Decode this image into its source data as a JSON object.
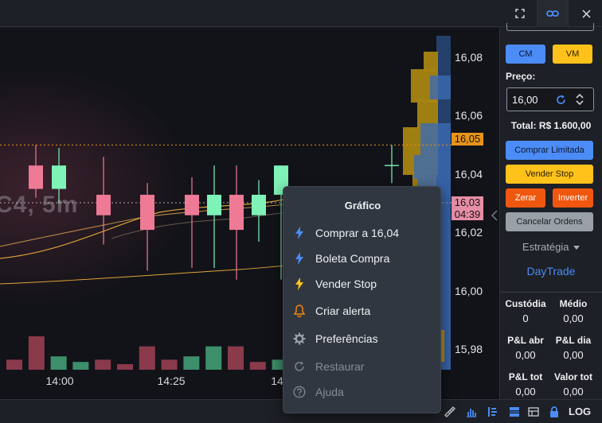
{
  "colors": {
    "bull": "#7ff2b8",
    "bear": "#ee7a95",
    "volume_bull": "#3c8f6a",
    "volume_bear": "#8a3a4b",
    "accent_blue": "#4b8cf6",
    "accent_yellow": "#ffc21a",
    "accent_orange": "#f0570e"
  },
  "chart": {
    "watermark": "C4, 5m",
    "last_price_tag": "16,05",
    "bid_tag": {
      "price": "16,03",
      "countdown": "04:39"
    },
    "price_axis": [
      "16,08",
      "16,06",
      "16,04",
      "16,02",
      "16,00",
      "15,98"
    ],
    "time_axis": [
      "14:00",
      "14:25",
      "14:"
    ]
  },
  "chart_data": {
    "type": "candlestick",
    "timeframe": "5m",
    "ylim": [
      15.97,
      16.09
    ],
    "x": [
      "14:00",
      "14:25"
    ],
    "candles": [
      {
        "open": 16.043,
        "close": 16.035,
        "high": 16.05,
        "low": 16.032
      },
      {
        "open": 16.035,
        "close": 16.043,
        "high": 16.049,
        "low": 16.03
      },
      {
        "open": 16.033,
        "close": 16.026,
        "high": 16.046,
        "low": 16.016
      },
      {
        "open": 16.033,
        "close": 16.021,
        "high": 16.037,
        "low": 16.007
      },
      {
        "open": 16.033,
        "close": 16.026,
        "high": 16.039,
        "low": 16.008
      },
      {
        "open": 16.026,
        "close": 16.033,
        "high": 16.043,
        "low": 16.008
      },
      {
        "open": 16.033,
        "close": 16.021,
        "high": 16.043,
        "low": 16.004
      },
      {
        "open": 16.026,
        "close": 16.033,
        "high": 16.038,
        "low": 16.017
      },
      {
        "open": 16.033,
        "close": 16.043,
        "high": 16.043,
        "low": 16.004
      },
      {
        "open": 16.043,
        "close": 16.043,
        "high": 16.05,
        "low": 16.037
      }
    ],
    "volume": [
      {
        "value": 9,
        "dir": "bear"
      },
      {
        "value": 30,
        "dir": "bear"
      },
      {
        "value": 12,
        "dir": "bull"
      },
      {
        "value": 7,
        "dir": "bull"
      },
      {
        "value": 9,
        "dir": "bear"
      },
      {
        "value": 5,
        "dir": "bear"
      },
      {
        "value": 21,
        "dir": "bear"
      },
      {
        "value": 9,
        "dir": "bear"
      },
      {
        "value": 12,
        "dir": "bull"
      },
      {
        "value": 21,
        "dir": "bull"
      },
      {
        "value": 21,
        "dir": "bear"
      },
      {
        "value": 7,
        "dir": "bear"
      },
      {
        "value": 9,
        "dir": "bull"
      },
      {
        "value": 15,
        "dir": "bull"
      },
      {
        "value": 16,
        "dir": "bull"
      }
    ],
    "last_price": 16.05,
    "bid_price": 16.03
  },
  "panel": {
    "cm_label": "CM",
    "vm_label": "VM",
    "price_label": "Preço:",
    "price_value": "16,00",
    "total": "Total: R$ 1.600,00",
    "buy_limit": "Comprar Limitada",
    "sell_stop": "Vender Stop",
    "zero": "Zerar",
    "invert": "Inverter",
    "cancel_orders": "Cancelar Ordens",
    "strategy_label": "Estratégia",
    "strategy_value": "DayTrade",
    "stats": {
      "custodia": {
        "label": "Custódia",
        "value": "0"
      },
      "medio": {
        "label": "Médio",
        "value": "0,00"
      },
      "pl_abr": {
        "label": "P&L abr",
        "value": "0,00"
      },
      "pl_dia": {
        "label": "P&L dia",
        "value": "0,00"
      },
      "pl_tot": {
        "label": "P&L tot",
        "value": "0,00"
      },
      "valor_tot": {
        "label": "Valor tot",
        "value": "0,00"
      }
    }
  },
  "menu": {
    "title": "Gráfico",
    "items": [
      {
        "label": "Comprar a 16,04",
        "icon": "lightning-blue-icon",
        "enabled": true
      },
      {
        "label": "Boleta Compra",
        "icon": "lightning-blue-icon",
        "enabled": true
      },
      {
        "label": "Vender Stop",
        "icon": "lightning-yellow-icon",
        "enabled": true
      },
      {
        "label": "Criar alerta",
        "icon": "bell-icon",
        "enabled": true
      },
      {
        "label": "Preferências",
        "icon": "gear-icon",
        "enabled": true
      },
      {
        "label": "Restaurar",
        "icon": "refresh-icon",
        "enabled": false
      },
      {
        "label": "Ajuda",
        "icon": "help-icon",
        "enabled": false
      }
    ]
  },
  "bottombar": {
    "log_label": "LOG"
  }
}
